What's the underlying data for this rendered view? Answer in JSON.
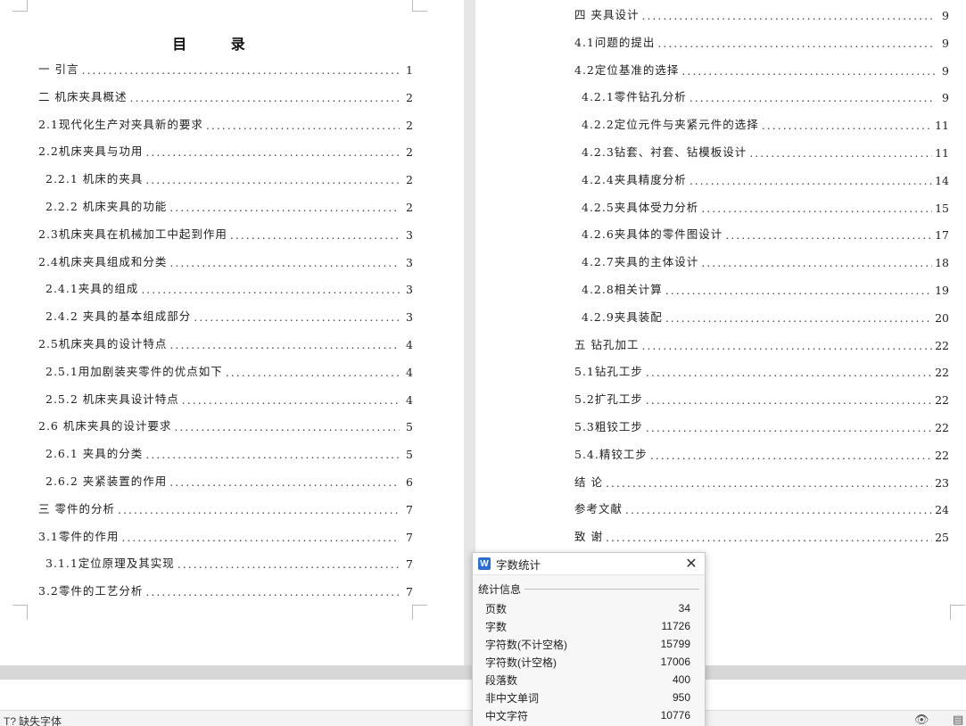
{
  "toc": {
    "title": "目 录",
    "left": [
      {
        "text": "一 引言",
        "page": "1"
      },
      {
        "text": "二 机床夹具概述",
        "page": "2"
      },
      {
        "text": "2.1现代化生产对夹具新的要求",
        "page": "2"
      },
      {
        "text": "2.2机床夹具与功用",
        "page": "2"
      },
      {
        "text": "2.2.1 机床的夹具",
        "page": "2"
      },
      {
        "text": "2.2.2 机床夹具的功能",
        "page": "2"
      },
      {
        "text": "2.3机床夹具在机械加工中起到作用",
        "page": "3"
      },
      {
        "text": "2.4机床夹具组成和分类",
        "page": "3"
      },
      {
        "text": "2.4.1夹具的组成",
        "page": "3"
      },
      {
        "text": "2.4.2 夹具的基本组成部分",
        "page": "3"
      },
      {
        "text": "2.5机床夹具的设计特点",
        "page": "4"
      },
      {
        "text": "2.5.1用加剧装夹零件的优点如下",
        "page": "4"
      },
      {
        "text": "2.5.2 机床夹具设计特点",
        "page": "4"
      },
      {
        "text": "2.6 机床夹具的设计要求",
        "page": "5"
      },
      {
        "text": "2.6.1  夹具的分类",
        "page": "5"
      },
      {
        "text": "2.6.2 夹紧装置的作用",
        "page": "6"
      },
      {
        "text": "三 零件的分析",
        "page": "7"
      },
      {
        "text": "3.1零件的作用",
        "page": "7"
      },
      {
        "text": "3.1.1定位原理及其实现",
        "page": "7"
      },
      {
        "text": "3.2零件的工艺分析",
        "page": "7"
      }
    ],
    "right": [
      {
        "text": "四 夹具设计",
        "page": "9"
      },
      {
        "text": "4.1问题的提出",
        "page": "9"
      },
      {
        "text": "4.2定位基准的选择",
        "page": "9"
      },
      {
        "text": "4.2.1零件钻孔分析",
        "page": "9"
      },
      {
        "text": "4.2.2定位元件与夹紧元件的选择",
        "page": "11"
      },
      {
        "text": "4.2.3钻套、衬套、钻模板设计",
        "page": "11"
      },
      {
        "text": "4.2.4夹具精度分析",
        "page": "14"
      },
      {
        "text": "4.2.5夹具体受力分析",
        "page": "15"
      },
      {
        "text": "4.2.6夹具体的零件图设计",
        "page": "17"
      },
      {
        "text": "4.2.7夹具的主体设计",
        "page": "18"
      },
      {
        "text": "4.2.8相关计算",
        "page": "19"
      },
      {
        "text": "4.2.9夹具装配",
        "page": "20"
      },
      {
        "text": "五 钻孔加工",
        "page": "22"
      },
      {
        "text": "5.1钻孔工步",
        "page": "22"
      },
      {
        "text": "5.2扩孔工步",
        "page": "22"
      },
      {
        "text": "5.3粗铰工步",
        "page": "22"
      },
      {
        "text": "5.4.精铰工步",
        "page": "22"
      },
      {
        "text": "结    论",
        "page": "23"
      },
      {
        "text": "参考文献",
        "page": "24"
      },
      {
        "text": "致    谢",
        "page": "25"
      }
    ]
  },
  "dialog": {
    "app_icon": "W",
    "title": "字数统计",
    "close_glyph": "✕",
    "section": "统计信息",
    "rows": [
      {
        "label": "页数",
        "value": "34"
      },
      {
        "label": "字数",
        "value": "11726"
      },
      {
        "label": "字符数(不计空格)",
        "value": "15799"
      },
      {
        "label": "字符数(计空格)",
        "value": "17006"
      },
      {
        "label": "段落数",
        "value": "400"
      },
      {
        "label": "非中文单词",
        "value": "950"
      },
      {
        "label": "中文字符",
        "value": "10776"
      }
    ]
  },
  "status": {
    "missing_font_icon": "T?",
    "missing_font": "缺失字体",
    "eye_icon": "👁",
    "view_icon": "▤"
  },
  "colors": {
    "dialog_accent": "#2b6fd6",
    "page_bg": "#ffffff",
    "workspace_bg": "#e6e6e6"
  }
}
